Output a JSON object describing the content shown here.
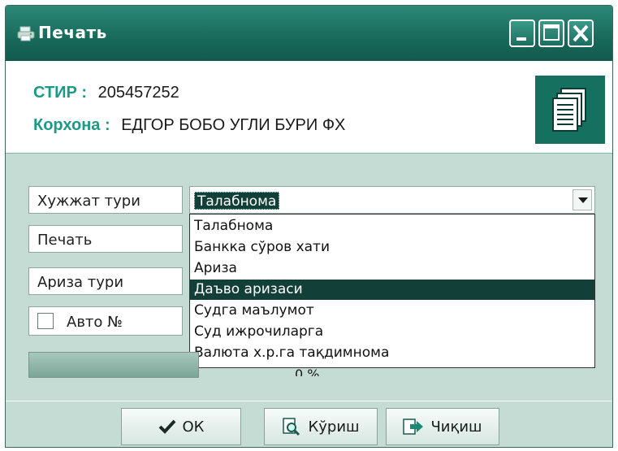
{
  "window": {
    "title": "Печать"
  },
  "header": {
    "stir_label": "СТИР :",
    "stir_value": "205457252",
    "company_label": "Корхона :",
    "company_value": "ЕДГОР БОБО УГЛИ БУРИ  ФХ",
    "icon": "documents-icon"
  },
  "form": {
    "doc_type_label": "Хужжат тури",
    "print_label": "Печать",
    "request_type_label": "Ариза тури",
    "auto_number_label": "Авто №",
    "auto_number_checked": false
  },
  "combo": {
    "selected": "Талабнома",
    "options": [
      "Талабнома",
      "Банкка сўров хати",
      "Ариза",
      "Даъво аризаси",
      "Судга маълумот",
      "Суд ижрочиларга",
      "Валюта х.р.га тақдимнома"
    ],
    "highlighted_index": 3
  },
  "progress": {
    "text": "0 %",
    "value_percent": 0
  },
  "buttons": {
    "ok": "ОК",
    "view": "Кўриш",
    "exit": "Чиқиш"
  },
  "colors": {
    "titlebar": "#186a5a",
    "accent_label": "#1b9a86",
    "selection": "#123f37",
    "panel": "#c5dcd4"
  }
}
